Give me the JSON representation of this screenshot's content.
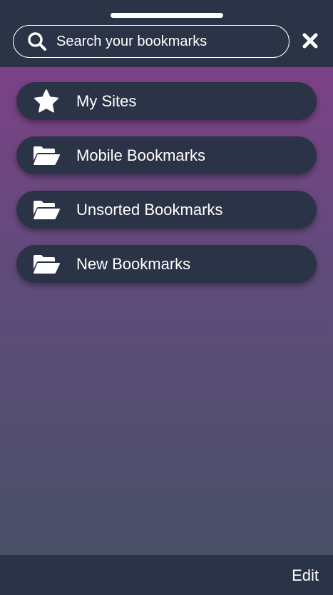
{
  "header": {
    "search": {
      "placeholder": "Search your bookmarks",
      "value": "",
      "icon": "search-icon"
    },
    "close_icon": "close-icon"
  },
  "bookmarks": {
    "items": [
      {
        "label": "My Sites",
        "icon": "star-icon"
      },
      {
        "label": "Mobile Bookmarks",
        "icon": "folder-open-icon"
      },
      {
        "label": "Unsorted Bookmarks",
        "icon": "folder-open-icon"
      },
      {
        "label": "New Bookmarks",
        "icon": "folder-open-icon"
      }
    ]
  },
  "footer": {
    "edit_label": "Edit"
  },
  "colors": {
    "bar_background": "#2b3346",
    "gradient_top": "#7c4186",
    "gradient_bottom": "#4a5068",
    "text": "#ffffff"
  }
}
